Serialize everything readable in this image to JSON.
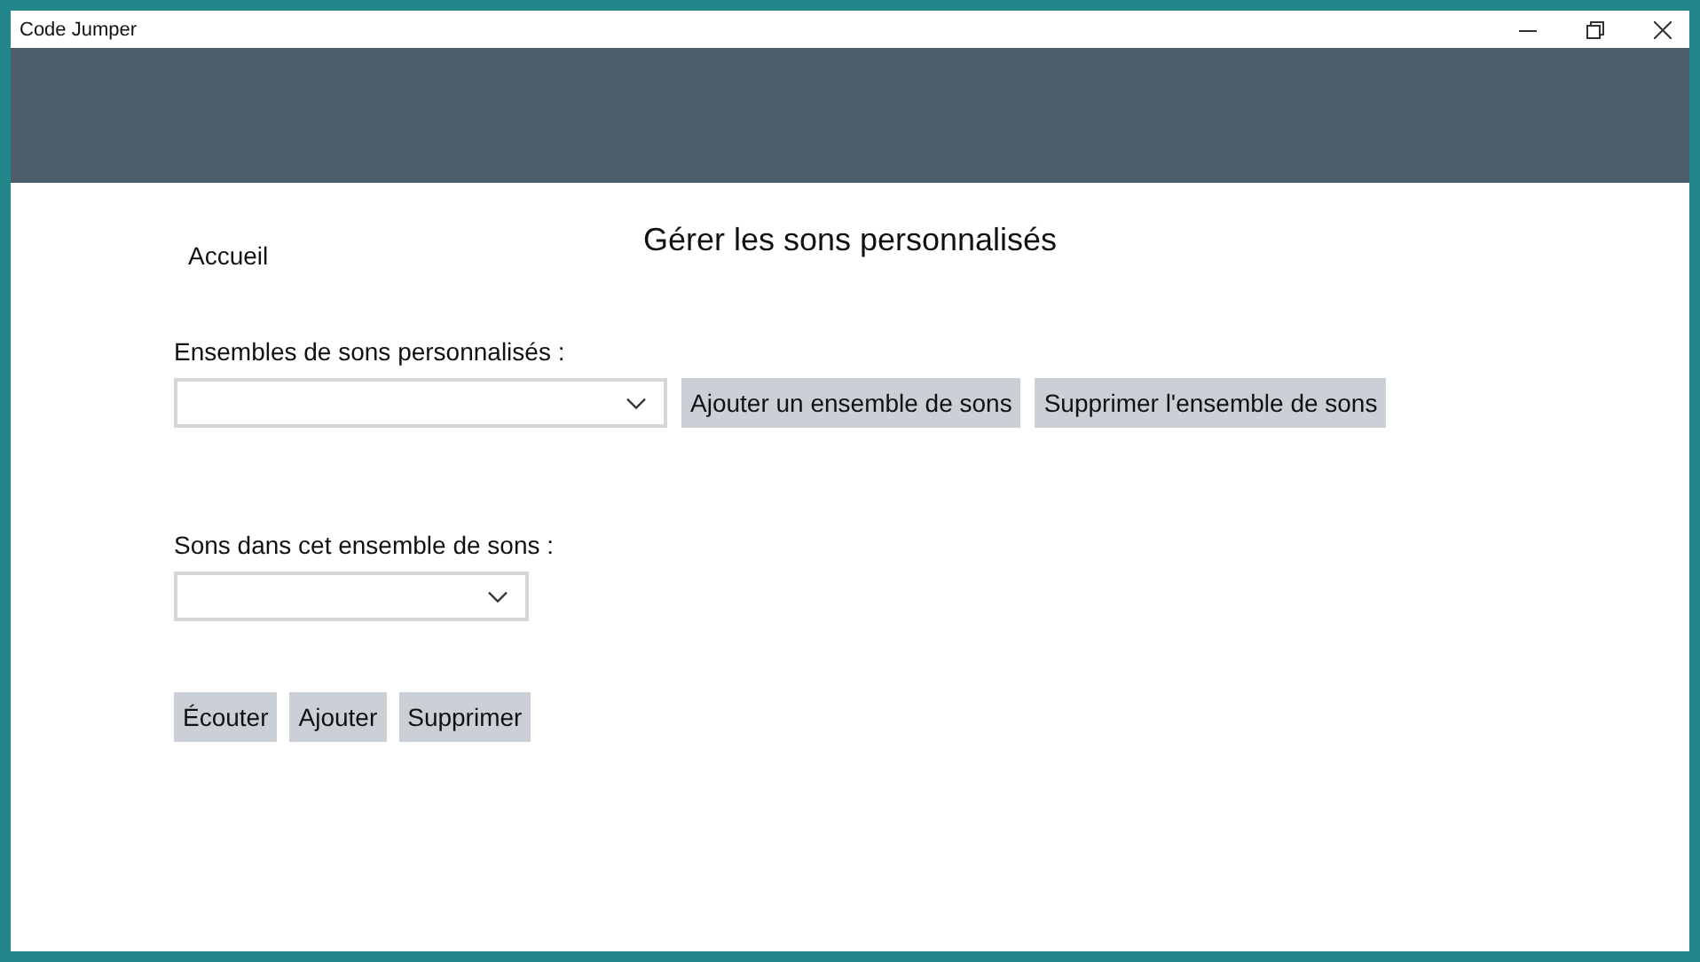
{
  "window": {
    "title": "Code Jumper"
  },
  "nav": {
    "label": "Accueil"
  },
  "page_title": "Gérer les sons personnalisés",
  "sound_sets": {
    "label": "Ensembles de sons personnalisés :",
    "buttons": [
      "Ajouter un ensemble de sons",
      "Supprimer l'ensemble de sons"
    ]
  },
  "sounds": {
    "label": "Sons dans cet ensemble de sons :",
    "buttons": [
      "Écouter",
      "Ajouter",
      "Supprimer"
    ]
  }
}
